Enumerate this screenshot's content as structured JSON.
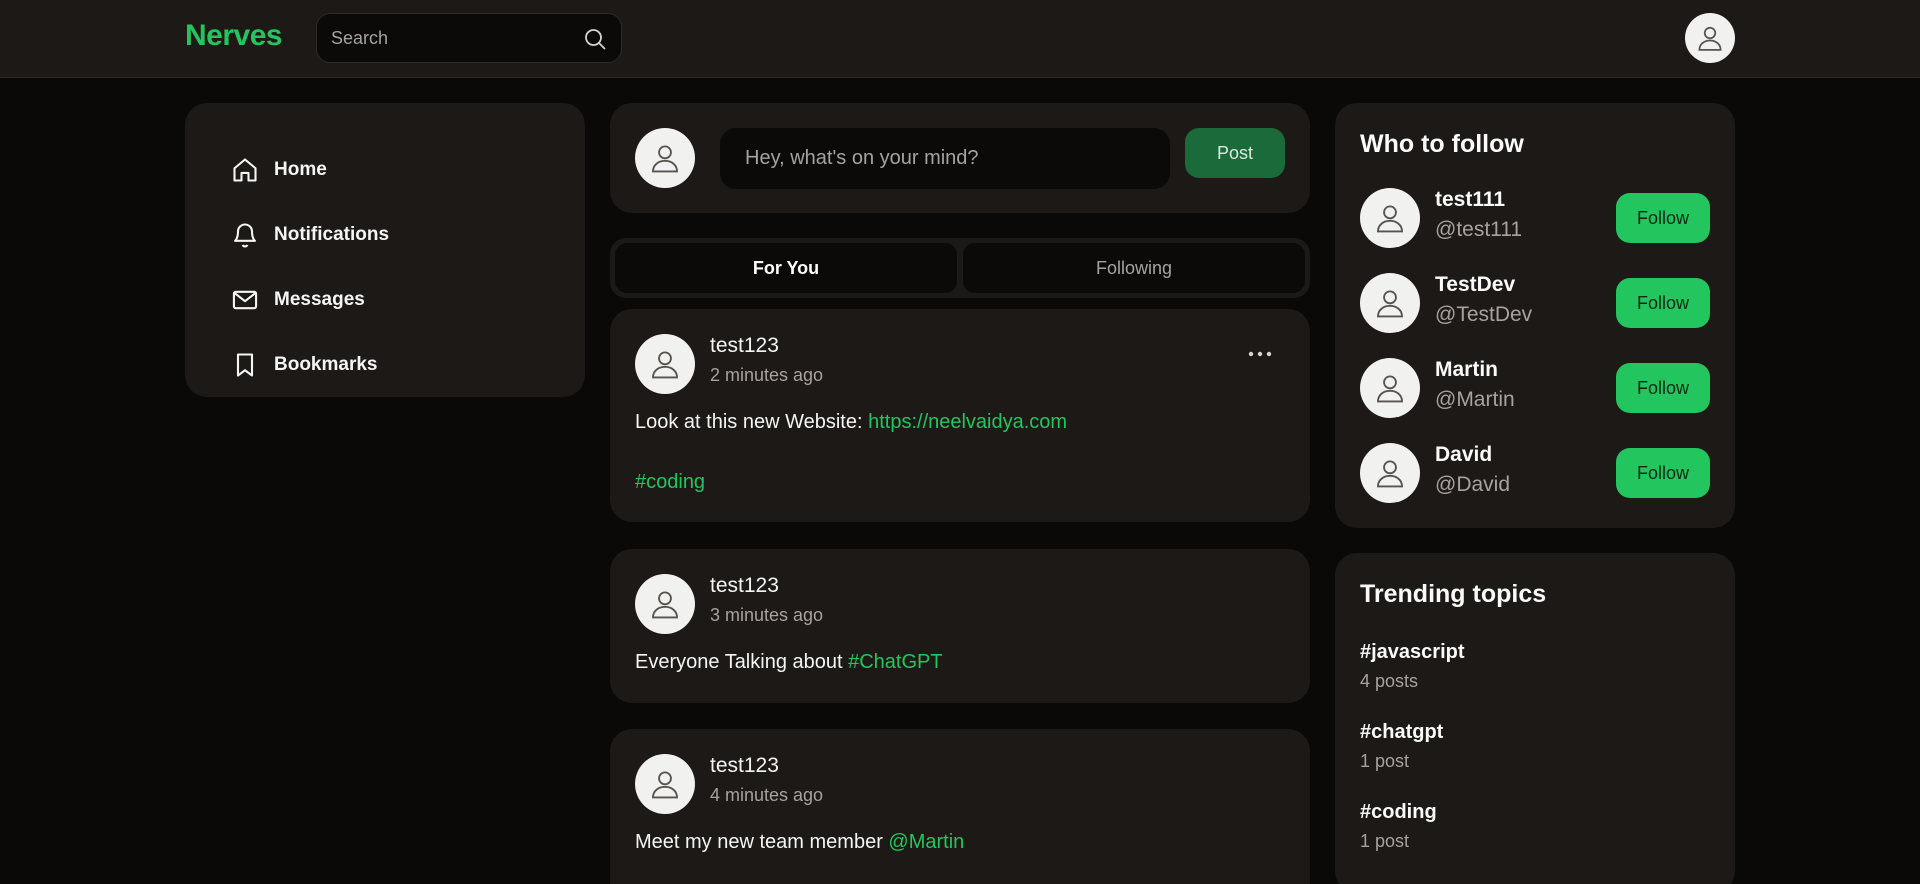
{
  "header": {
    "logo": "Nerves",
    "search_placeholder": "Search"
  },
  "nav": {
    "items": [
      {
        "label": "Home",
        "icon": "home-icon"
      },
      {
        "label": "Notifications",
        "icon": "bell-icon"
      },
      {
        "label": "Messages",
        "icon": "mail-icon"
      },
      {
        "label": "Bookmarks",
        "icon": "bookmark-icon"
      }
    ]
  },
  "composer": {
    "placeholder": "Hey, what's on your mind?",
    "post_label": "Post"
  },
  "tabs": [
    {
      "label": "For You",
      "active": true
    },
    {
      "label": "Following",
      "active": false
    }
  ],
  "posts": [
    {
      "author": "test123",
      "time": "2 minutes ago",
      "text": "Look at this new Website: ",
      "link": "https://neelvaidya.com",
      "hashtag": "#coding"
    },
    {
      "author": "test123",
      "time": "3 minutes ago",
      "text": "Everyone Talking about ",
      "hashtag": "#ChatGPT"
    },
    {
      "author": "test123",
      "time": "4 minutes ago",
      "text": "Meet my new team member ",
      "mention": "@Martin"
    }
  ],
  "who_to_follow": {
    "title": "Who to follow",
    "button_label": "Follow",
    "users": [
      {
        "name": "test111",
        "handle": "@test111"
      },
      {
        "name": "TestDev",
        "handle": "@TestDev"
      },
      {
        "name": "Martin",
        "handle": "@Martin"
      },
      {
        "name": "David",
        "handle": "@David"
      }
    ]
  },
  "trending": {
    "title": "Trending topics",
    "topics": [
      {
        "tag": "#javascript",
        "count": "4 posts"
      },
      {
        "tag": "#chatgpt",
        "count": "1 post"
      },
      {
        "tag": "#coding",
        "count": "1 post"
      }
    ]
  },
  "colors": {
    "accent": "#22c55e",
    "background": "#0a0908",
    "panel": "#1c1917"
  }
}
